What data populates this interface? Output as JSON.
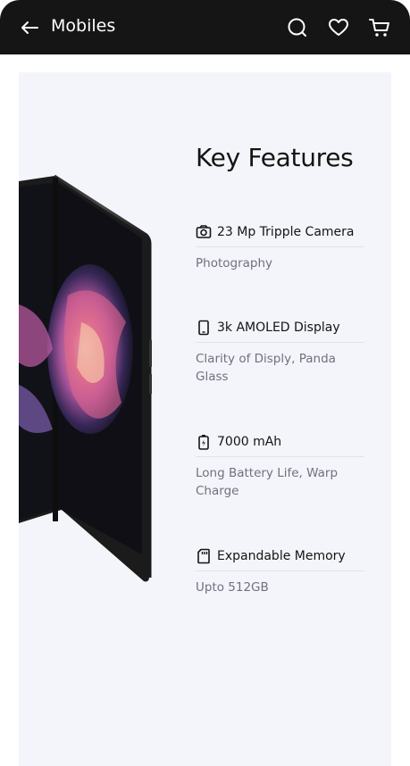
{
  "header": {
    "title": "Mobiles",
    "icons": [
      "back-arrow-icon",
      "search-icon",
      "heart-icon",
      "cart-icon"
    ]
  },
  "section": {
    "heading": "Key Features"
  },
  "features": [
    {
      "icon": "camera-icon",
      "title": "23 Mp Tripple Camera",
      "desc": "Photography"
    },
    {
      "icon": "phone-icon",
      "title": "3k AMOLED Display",
      "desc": "Clarity of Disply, Panda Glass"
    },
    {
      "icon": "battery-icon",
      "title": "7000 mAh",
      "desc": "Long Battery Life, Warp Charge"
    },
    {
      "icon": "sd-card-icon",
      "title": "Expandable Memory",
      "desc": "Upto 512GB"
    }
  ],
  "colors": {
    "header_bg": "#151515",
    "card_bg": "#f4f5fa",
    "text_primary": "#141414",
    "text_secondary": "#6d7280"
  }
}
